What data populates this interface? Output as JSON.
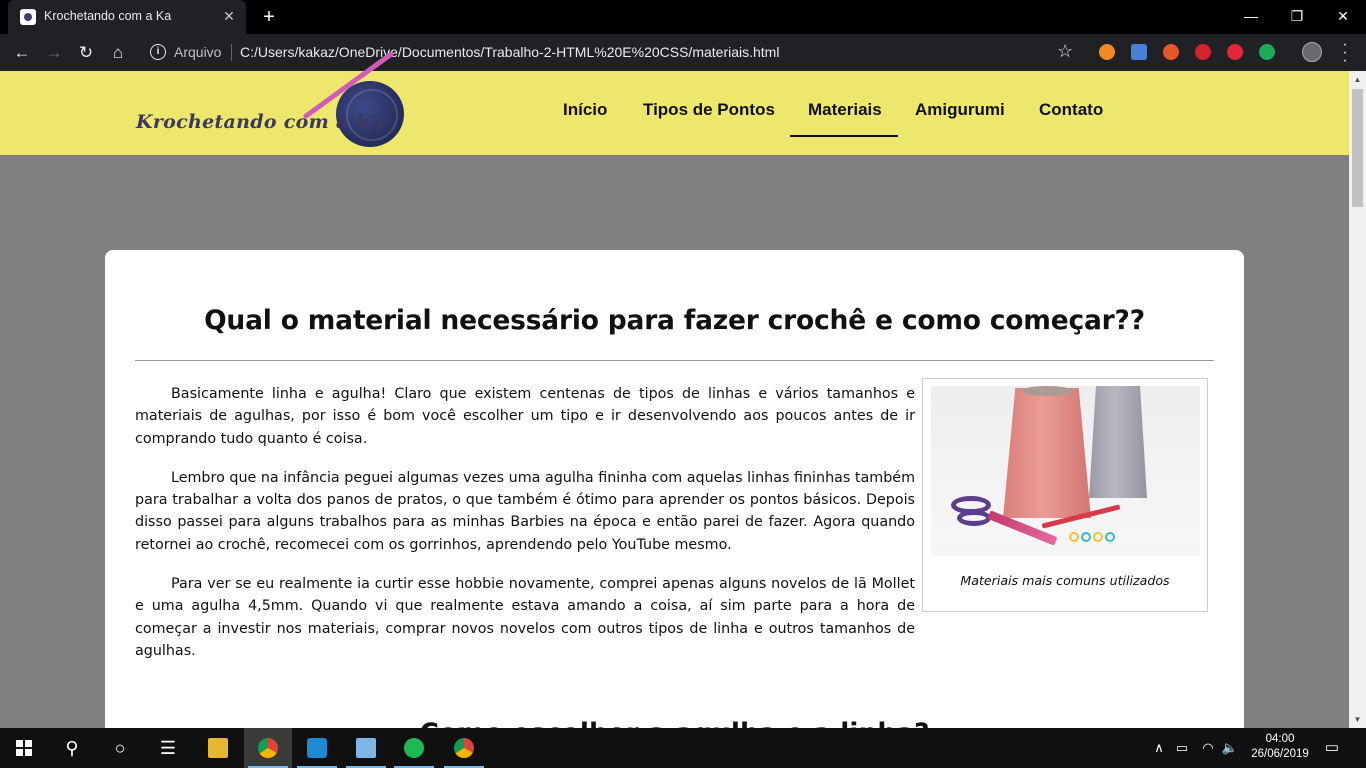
{
  "browser": {
    "tab_title": "Krochetando com a Ka",
    "tab_close": "✕",
    "new_tab": "+",
    "url_scheme": "Arquivo",
    "url": "C:/Users/kakaz/OneDrive/Documentos/Trabalho-2-HTML%20E%20CSS/materiais.html",
    "window_controls": [
      "—",
      "❐",
      "✕"
    ]
  },
  "site": {
    "logo_text": "Krochetando com a Ka",
    "nav": [
      "Início",
      "Tipos de Pontos",
      "Materiais",
      "Amigurumi",
      "Contato"
    ],
    "active_nav": "Materiais"
  },
  "content": {
    "title": "Qual o material necessário para fazer crochê e como começar??",
    "paragraphs": [
      "Basicamente linha e agulha! Claro que existem centenas de tipos de linhas e vários tamanhos e materiais de agulhas, por isso é bom você escolher um tipo e ir desenvolvendo aos poucos antes de ir comprando tudo quanto é coisa.",
      "Lembro que na infância peguei algumas vezes uma agulha fininha com aquelas linhas fininhas também para trabalhar a volta dos panos de pratos, o que também é ótimo para aprender os pontos básicos. Depois disso passei para alguns trabalhos para as minhas Barbies na época e então parei de fazer. Agora quando retornei ao crochê, recomecei com os gorrinhos, aprendendo pelo YouTube mesmo.",
      "Para ver se eu realmente ia curtir esse hobbie novamente, comprei apenas alguns novelos de lã Mollet e uma agulha 4,5mm. Quando vi que realmente estava amando a coisa, aí sim parte para a hora de começar a investir nos materiais, comprar novos novelos com outros tipos de linha e outros tamanhos de agulhas."
    ],
    "figure_caption": "Materiais mais comuns utilizados",
    "next_heading": "Como escolher a agulha e a linha?"
  },
  "taskbar": {
    "time": "04:00",
    "date": "26/06/2019"
  },
  "colors": {
    "header_bg": "#ede76e",
    "page_bg": "#808080",
    "card_bg": "#ffffff"
  }
}
